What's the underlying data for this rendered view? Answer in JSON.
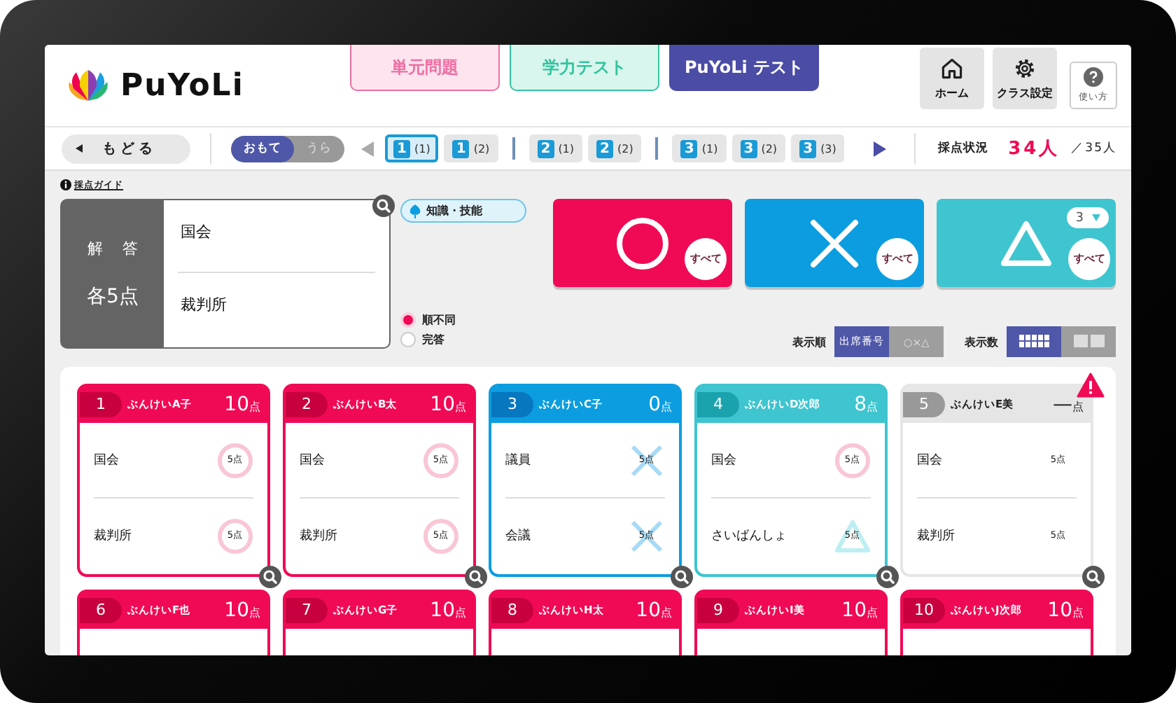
{
  "app": {
    "logo": "PuYoLi"
  },
  "tabs": [
    {
      "label": "単元問題",
      "kind": "unit",
      "selected": false
    },
    {
      "label": "学力テスト",
      "kind": "ability",
      "selected": false
    },
    {
      "label": "PuYoLi テスト",
      "kind": "puyoli",
      "selected": true
    }
  ],
  "header_buttons": [
    {
      "label": "ホーム",
      "kind": "home"
    },
    {
      "label": "クラス設定",
      "kind": "settings"
    },
    {
      "label": "使い方",
      "kind": "help"
    }
  ],
  "toolbar": {
    "back": "もどる",
    "sides": [
      {
        "label": "おもて",
        "selected": true
      },
      {
        "label": "うら",
        "selected": false
      }
    ],
    "questions": [
      {
        "number": "1",
        "part": "(1)",
        "selected": true
      },
      {
        "number": "1",
        "part": "(2)",
        "selected": false
      },
      {
        "number": "2",
        "part": "(1)",
        "selected": false
      },
      {
        "number": "2",
        "part": "(2)",
        "selected": false
      },
      {
        "number": "3",
        "part": "(1)",
        "selected": false
      },
      {
        "number": "3",
        "part": "(2)",
        "selected": false
      },
      {
        "number": "3",
        "part": "(3)",
        "selected": false
      }
    ],
    "status": {
      "label": "採点状況",
      "count": "34人",
      "total": "／35人"
    }
  },
  "guide": {
    "link": "採点ガイド",
    "heading": "解答",
    "points": "各5点",
    "answers": [
      "国会",
      "裁判所"
    ],
    "tag": "知識・技能",
    "options": [
      {
        "label": "順不同",
        "selected": true
      },
      {
        "label": "完答",
        "selected": false
      }
    ]
  },
  "mark_buttons": [
    {
      "kind": "circle",
      "all_label": "すべて"
    },
    {
      "kind": "cross",
      "all_label": "すべて"
    },
    {
      "kind": "triangle",
      "all_label": "すべて",
      "count": "3"
    }
  ],
  "display_order": {
    "label": "表示順",
    "options": [
      {
        "label": "出席番号",
        "selected": true
      },
      {
        "label": "○×△",
        "selected": false
      }
    ]
  },
  "display_count": {
    "label": "表示数",
    "options": [
      {
        "kind": "grid",
        "selected": true
      },
      {
        "kind": "large",
        "selected": false
      }
    ]
  },
  "cards": [
    {
      "number": "1",
      "name": "ぶんけいA子",
      "score": "10",
      "unit": "点",
      "kind": "correct",
      "answers": [
        {
          "text": "国会",
          "points": "5点",
          "kind": "circle"
        },
        {
          "text": "裁判所",
          "points": "5点",
          "kind": "circle"
        }
      ]
    },
    {
      "number": "2",
      "name": "ぶんけいB太",
      "score": "10",
      "unit": "点",
      "kind": "correct",
      "answers": [
        {
          "text": "国会",
          "points": "5点",
          "kind": "circle"
        },
        {
          "text": "裁判所",
          "points": "5点",
          "kind": "circle"
        }
      ]
    },
    {
      "number": "3",
      "name": "ぶんけいC子",
      "score": "0",
      "unit": "点",
      "kind": "wrong",
      "answers": [
        {
          "text": "議員",
          "points": "5点",
          "kind": "cross"
        },
        {
          "text": "会議",
          "points": "5点",
          "kind": "cross"
        }
      ]
    },
    {
      "number": "4",
      "name": "ぶんけいD次郎",
      "score": "8",
      "unit": "点",
      "kind": "partial",
      "answers": [
        {
          "text": "国会",
          "points": "5点",
          "kind": "circle"
        },
        {
          "text": "さいばんしょ",
          "points": "5点",
          "kind": "triangle"
        }
      ]
    },
    {
      "number": "5",
      "name": "ぶんけいE美",
      "score": "—",
      "unit": "点",
      "kind": "ungraded",
      "warning": true,
      "answers": [
        {
          "text": "国会",
          "points": "5点",
          "kind": "plain"
        },
        {
          "text": "裁判所",
          "points": "5点",
          "kind": "plain"
        }
      ]
    },
    {
      "number": "6",
      "name": "ぶんけいF也",
      "score": "10",
      "unit": "点",
      "kind": "correct"
    },
    {
      "number": "7",
      "name": "ぶんけいG子",
      "score": "10",
      "unit": "点",
      "kind": "correct"
    },
    {
      "number": "8",
      "name": "ぶんけいH太",
      "score": "10",
      "unit": "点",
      "kind": "correct"
    },
    {
      "number": "9",
      "name": "ぶんけいI美",
      "score": "10",
      "unit": "点",
      "kind": "correct"
    },
    {
      "number": "10",
      "name": "ぶんけいJ次郎",
      "score": "10",
      "unit": "点",
      "kind": "correct"
    }
  ]
}
